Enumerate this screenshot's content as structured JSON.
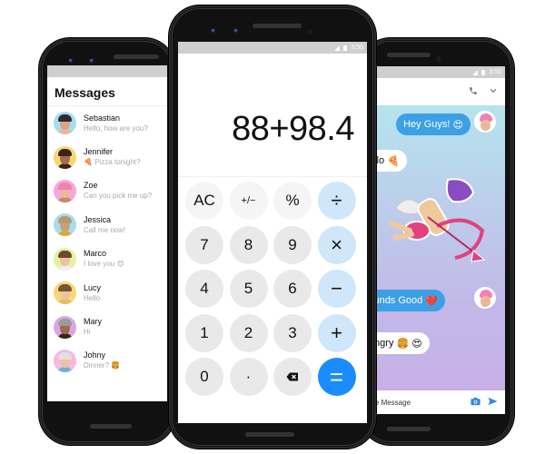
{
  "status_bar": {
    "time": "3:50"
  },
  "messages_app": {
    "title": "Messages",
    "conversations": [
      {
        "name": "Sebastian",
        "preview": "Hello, how are you?",
        "emoji": "",
        "lead_emoji": "",
        "avatar_bg": "#a6dcf2",
        "hair": "#2b2b2b",
        "skin": "#d9a585",
        "shirt": "#e8b999"
      },
      {
        "name": "Jennifer",
        "preview": "Pizza tonight?",
        "emoji": "",
        "lead_emoji": "🍕",
        "avatar_bg": "#f7d774",
        "hair": "#3a2418",
        "skin": "#a86a4a",
        "shirt": "#3a2418"
      },
      {
        "name": "Zoe",
        "preview": "Can you pick me up?",
        "emoji": "",
        "lead_emoji": "",
        "avatar_bg": "#f5a8d9",
        "hair": "#f27fb9",
        "skin": "#e8b999",
        "shirt": "#c48a6a"
      },
      {
        "name": "Jessica",
        "preview": "Call me now!",
        "emoji": "",
        "lead_emoji": "",
        "avatar_bg": "#a6dcf2",
        "hair": "#b89a6a",
        "skin": "#caa07a",
        "shirt": "#e0a83a"
      },
      {
        "name": "Marco",
        "preview": "I love you",
        "emoji": "😍",
        "lead_emoji": "",
        "avatar_bg": "#e1f3a0",
        "hair": "#6a4a2a",
        "skin": "#eac3a0",
        "shirt": "#f0f0f0"
      },
      {
        "name": "Lucy",
        "preview": "Hello",
        "emoji": "",
        "lead_emoji": "",
        "avatar_bg": "#f7d774",
        "hair": "#7a5230",
        "skin": "#eac3a0",
        "shirt": "#e0c060"
      },
      {
        "name": "Mary",
        "preview": "Hi",
        "emoji": "",
        "lead_emoji": "",
        "avatar_bg": "#d8a6e8",
        "hair": "#9a9a9a",
        "skin": "#9a6a4a",
        "shirt": "#3a2418"
      },
      {
        "name": "Johny",
        "preview": "Dinner?",
        "emoji": "🍔",
        "lead_emoji": "",
        "avatar_bg": "#f5b8e3",
        "hair": "#e0e0e0",
        "skin": "#eac3a0",
        "shirt": "#6ab0e0"
      }
    ]
  },
  "calculator_app": {
    "display": "88+98.4",
    "keys": [
      {
        "label": "AC",
        "kind": "fn",
        "name": "all-clear"
      },
      {
        "label": "+/−",
        "kind": "fn",
        "name": "toggle-sign"
      },
      {
        "label": "%",
        "kind": "fn",
        "name": "percent"
      },
      {
        "label": "÷",
        "kind": "op",
        "name": "divide"
      },
      {
        "label": "7",
        "kind": "num",
        "name": "digit-7"
      },
      {
        "label": "8",
        "kind": "num",
        "name": "digit-8"
      },
      {
        "label": "9",
        "kind": "num",
        "name": "digit-9"
      },
      {
        "label": "×",
        "kind": "op",
        "name": "multiply"
      },
      {
        "label": "4",
        "kind": "num",
        "name": "digit-4"
      },
      {
        "label": "5",
        "kind": "num",
        "name": "digit-5"
      },
      {
        "label": "6",
        "kind": "num",
        "name": "digit-6"
      },
      {
        "label": "−",
        "kind": "op",
        "name": "subtract"
      },
      {
        "label": "1",
        "kind": "num",
        "name": "digit-1"
      },
      {
        "label": "2",
        "kind": "num",
        "name": "digit-2"
      },
      {
        "label": "3",
        "kind": "num",
        "name": "digit-3"
      },
      {
        "label": "+",
        "kind": "op",
        "name": "add"
      },
      {
        "label": "0",
        "kind": "num",
        "name": "digit-0"
      },
      {
        "label": "·",
        "kind": "num",
        "name": "decimal-point"
      },
      {
        "label": "⌫",
        "kind": "num",
        "name": "backspace"
      },
      {
        "label": "=",
        "kind": "eq",
        "name": "equals"
      }
    ],
    "colors": {
      "operator_bg": "#cfe6fb",
      "equals_bg": "#1a8cff",
      "digit_bg": "#e9e9e9"
    }
  },
  "chat_app": {
    "header_icons": [
      "phone-icon",
      "chevron-down-icon"
    ],
    "messages": [
      {
        "text": "Hey Guys!",
        "emoji": "😍",
        "direction": "outgoing"
      },
      {
        "text": "Hello",
        "emoji": "🍕",
        "direction": "incoming"
      },
      {
        "text": "Sounds Good",
        "emoji": "❤️",
        "direction": "outgoing"
      },
      {
        "text": "Hungry",
        "emoji": "🍔 😍",
        "direction": "incoming"
      }
    ],
    "sticker": "cupid-sticker",
    "input_placeholder": "Type Message",
    "colors": {
      "outgoing_bubble": "#3d9fe6",
      "incoming_bubble": "#ffffff",
      "send": "#2e86d8"
    }
  }
}
